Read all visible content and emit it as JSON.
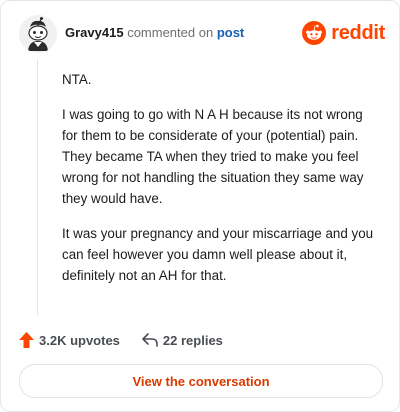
{
  "header": {
    "username": "Gravy415",
    "action_text": "commented on",
    "post_link": "post",
    "brand": "reddit"
  },
  "comment": {
    "paragraphs": [
      "NTA.",
      "I was going to go with N A H because its not wrong for them to be considerate of your (potential) pain. They became TA when they tried to make you feel wrong for not handling the situation they same way they would have.",
      "It was your pregnancy and your miscarriage and you can feel however you damn well please about it, definitely not an AH for that."
    ]
  },
  "stats": {
    "upvotes": "3.2K upvotes",
    "replies": "22 replies"
  },
  "cta": {
    "label": "View the conversation"
  },
  "colors": {
    "brand": "#ff4500",
    "link": "#1a5fb4",
    "cta_text": "#d93a00"
  },
  "icons": [
    "avatar-snoo-icon",
    "reddit-logo-icon",
    "upvote-arrow-icon",
    "reply-arrow-icon"
  ]
}
